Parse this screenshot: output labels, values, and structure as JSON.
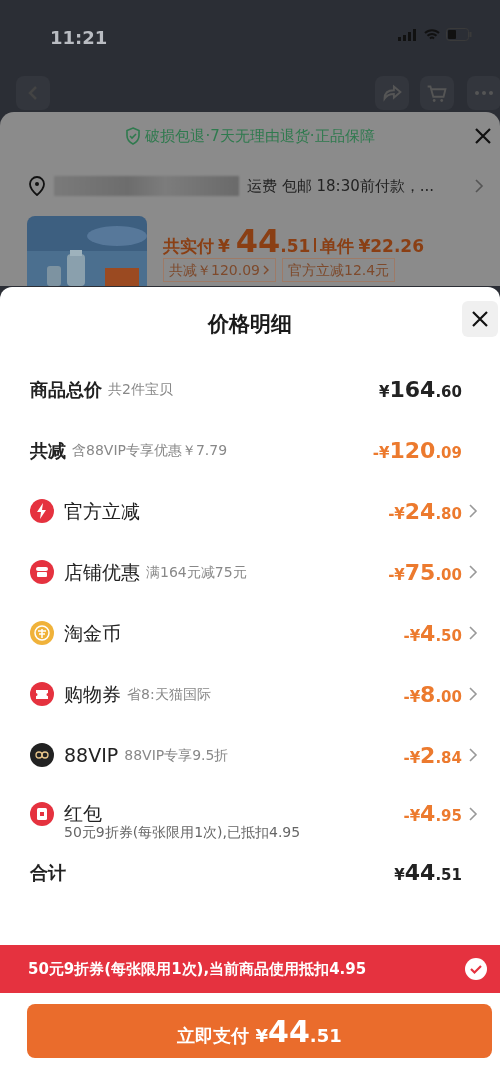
{
  "status_bar": {
    "time": "11:21"
  },
  "background_sheet": {
    "guarantee": "破损包退·7天无理由退货·正品保障",
    "shipping": "运费 包邮 18:30前付款，...",
    "paid_label": "共实付",
    "paid_amount": "¥ 44.51",
    "unit_label": "单件",
    "unit_price": "¥22.26",
    "tags": [
      {
        "text": "共减￥120.09",
        "chevron": true
      },
      {
        "text": "官方立减12.4元",
        "chevron": false
      }
    ]
  },
  "sheet": {
    "title": "价格明细",
    "rows": [
      {
        "kind": "summary",
        "label": "商品总价",
        "detail": "共2件宝贝",
        "amount": "¥164.60",
        "accent": false,
        "chevron": false
      },
      {
        "kind": "summary",
        "label": "共减",
        "detail": "含88VIP专享优惠￥7.79",
        "amount": "-¥120.09",
        "accent": true,
        "chevron": false
      },
      {
        "kind": "discount",
        "label": "官方立减",
        "amount": "-¥24.80",
        "accent": true,
        "chevron": true
      },
      {
        "kind": "discount",
        "label": "店铺优惠",
        "detail": "满164元减75元",
        "amount": "-¥75.00",
        "accent": true,
        "chevron": true
      },
      {
        "kind": "discount",
        "label": "淘金币",
        "amount": "-¥4.50",
        "accent": true,
        "chevron": true
      },
      {
        "kind": "discount",
        "label": "购物券",
        "detail": "省8:天猫国际",
        "amount": "-¥8.00",
        "accent": true,
        "chevron": true
      },
      {
        "kind": "discount",
        "label": "88VIP",
        "detail": "88VIP专享9.5折",
        "amount": "-¥2.84",
        "accent": true,
        "chevron": true
      },
      {
        "kind": "discount",
        "label": "红包",
        "amount": "-¥4.95",
        "accent": true,
        "chevron": true,
        "note": "50元9折券(每张限用1次),已抵扣4.95"
      }
    ],
    "total": {
      "label": "合计",
      "amount": "¥44.51"
    }
  },
  "coupon_banner": {
    "text": "50元9折券(每张限用1次),当前商品使用抵扣4.95",
    "checked": true
  },
  "pay_button": {
    "label": "立即支付",
    "amount": "¥44.51"
  }
}
